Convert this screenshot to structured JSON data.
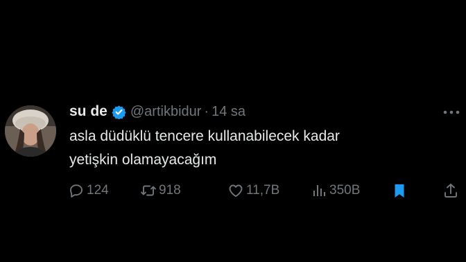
{
  "tweet": {
    "display_name": "su de",
    "handle": "@artikbidur",
    "separator": "·",
    "timestamp": "14 sa",
    "text_line1": "asla düdüklü tencere kullanabilecek kadar",
    "text_line2": "yetişkin olamayacağım"
  },
  "actions": {
    "replies": "124",
    "reposts": "918",
    "likes": "11,7B",
    "views": "350B"
  },
  "icons": {
    "verified": "verified-badge-icon",
    "more": "more-horizontal-icon",
    "reply": "reply-bubble-icon",
    "repost": "repost-arrows-icon",
    "like": "heart-icon",
    "views": "bar-chart-icon",
    "bookmark": "bookmark-icon",
    "share": "share-upload-icon"
  },
  "colors": {
    "background": "#000000",
    "text_primary": "#e7e9ea",
    "text_secondary": "#71767b",
    "accent_blue": "#1d9bf0"
  }
}
